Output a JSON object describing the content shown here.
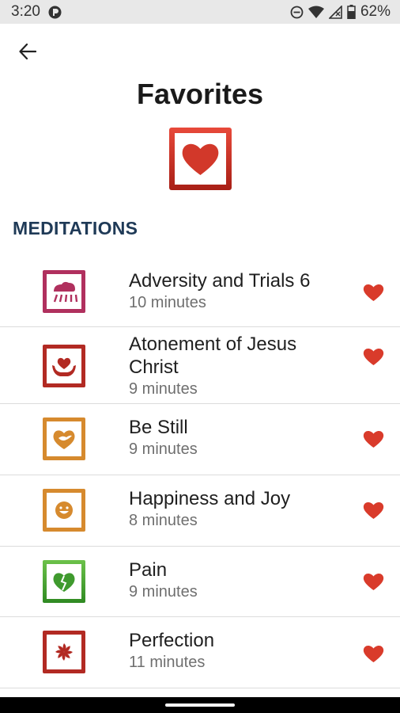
{
  "status_bar": {
    "time": "3:20",
    "battery": "62%"
  },
  "header": {
    "title": "Favorites"
  },
  "section": {
    "label": "MEDITATIONS"
  },
  "colors": {
    "heart": "#d93b2b",
    "section_label": "#1f3a57"
  },
  "items": [
    {
      "title": "Adversity and Trials 6",
      "duration": "10 minutes",
      "icon": "rain-cloud-icon",
      "color": "#b0305e"
    },
    {
      "title": "Atonement of Jesus Christ",
      "duration": "9 minutes",
      "icon": "hands-heart-icon",
      "color": "#b22a23"
    },
    {
      "title": "Be Still",
      "duration": "9 minutes",
      "icon": "dove-heart-icon",
      "color": "#d68a2e"
    },
    {
      "title": "Happiness and Joy",
      "duration": "8 minutes",
      "icon": "smiley-icon",
      "color": "#d68a2e"
    },
    {
      "title": "Pain",
      "duration": "9 minutes",
      "icon": "broken-heart-icon",
      "color": "#3f9a2e"
    },
    {
      "title": "Perfection",
      "duration": "11 minutes",
      "icon": "swirl-flower-icon",
      "color": "#b22a23"
    }
  ]
}
